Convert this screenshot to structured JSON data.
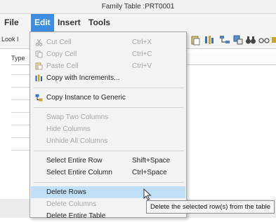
{
  "window": {
    "title": "Family Table :PRT0001"
  },
  "menubar": {
    "file": "File",
    "edit": "Edit",
    "insert": "Insert",
    "tools": "Tools"
  },
  "toolbar": {
    "look_in_label": "Look I"
  },
  "grid": {
    "type_header": "Type"
  },
  "edit_menu": {
    "cut": {
      "label": "Cut Cell",
      "shortcut": "Ctrl+X"
    },
    "copy": {
      "label": "Copy Cell",
      "shortcut": "Ctrl+C"
    },
    "paste": {
      "label": "Paste Cell",
      "shortcut": "Ctrl+V"
    },
    "copy_increments": {
      "label": "Copy with Increments..."
    },
    "copy_instance": {
      "label": "Copy Instance to Generic"
    },
    "swap_columns": {
      "label": "Swap Two Columns"
    },
    "hide_columns": {
      "label": "Hide Columns"
    },
    "unhide_columns": {
      "label": "Unhide All Columns"
    },
    "select_row": {
      "label": "Select Entire Row",
      "shortcut": "Shift+Space"
    },
    "select_column": {
      "label": "Select Entire Column",
      "shortcut": "Ctrl+Space"
    },
    "delete_rows": {
      "label": "Delete Rows"
    },
    "delete_columns": {
      "label": "Delete Columns"
    },
    "delete_table": {
      "label": "Delete Entire Table"
    }
  },
  "tooltip": {
    "text": "Delete the selected row(s) from the table"
  },
  "colors": {
    "menu_active": "#3c8de0",
    "hover_row": "#bfe0f7",
    "disabled_text": "#a6a6a6"
  }
}
